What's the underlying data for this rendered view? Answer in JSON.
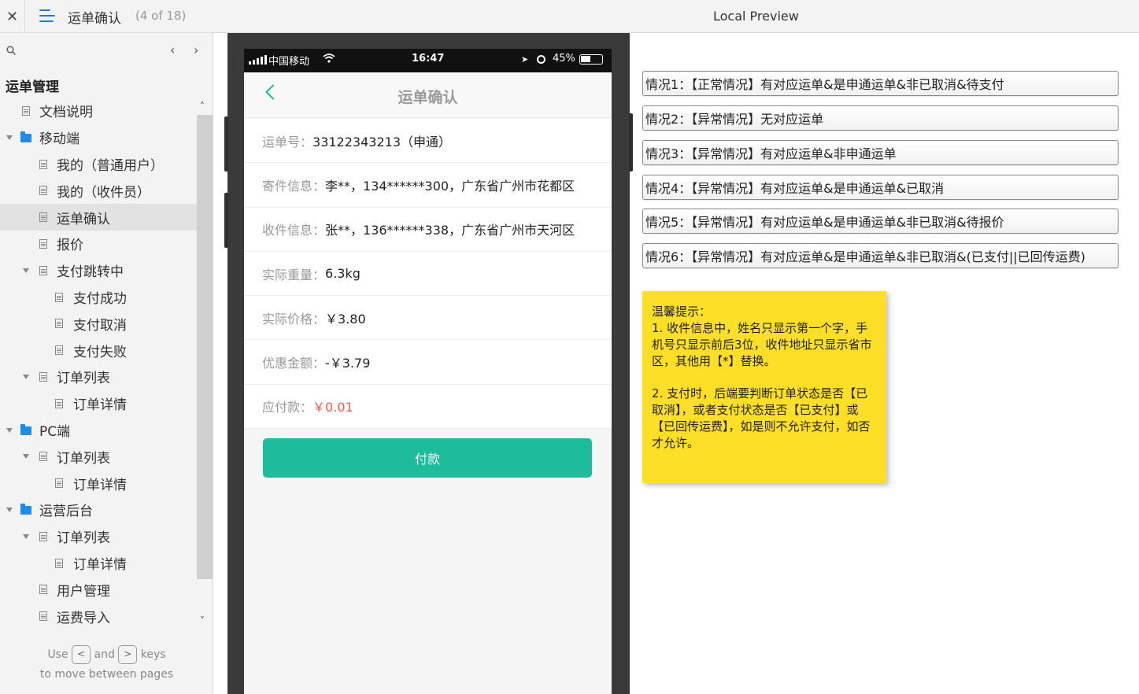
{
  "topbar": {
    "close_glyph": "✕",
    "page_title": "运单确认",
    "page_count": "(4 of 18)",
    "preview_title": "Local Preview"
  },
  "sidebar": {
    "tree_title": "运单管理",
    "items": [
      {
        "label": "文档说明",
        "type": "doc",
        "level": 1,
        "expanded": null,
        "selected": false
      },
      {
        "label": "移动端",
        "type": "folder",
        "level": 0,
        "expanded": true,
        "selected": false
      },
      {
        "label": "我的（普通用户）",
        "type": "doc",
        "level": 2,
        "expanded": null,
        "selected": false
      },
      {
        "label": "我的（收件员）",
        "type": "doc",
        "level": 2,
        "expanded": null,
        "selected": false
      },
      {
        "label": "运单确认",
        "type": "doc",
        "level": 2,
        "expanded": null,
        "selected": true
      },
      {
        "label": "报价",
        "type": "doc",
        "level": 2,
        "expanded": null,
        "selected": false
      },
      {
        "label": "支付跳转中",
        "type": "doc",
        "level": 1,
        "expanded": true,
        "selected": false
      },
      {
        "label": "支付成功",
        "type": "doc",
        "level": 3,
        "expanded": null,
        "selected": false
      },
      {
        "label": "支付取消",
        "type": "doc",
        "level": 3,
        "expanded": null,
        "selected": false
      },
      {
        "label": "支付失败",
        "type": "doc",
        "level": 3,
        "expanded": null,
        "selected": false
      },
      {
        "label": "订单列表",
        "type": "doc",
        "level": 1,
        "expanded": true,
        "selected": false
      },
      {
        "label": "订单详情",
        "type": "doc",
        "level": 3,
        "expanded": null,
        "selected": false
      },
      {
        "label": "PC端",
        "type": "folder",
        "level": 0,
        "expanded": true,
        "selected": false
      },
      {
        "label": "订单列表",
        "type": "doc",
        "level": 1,
        "expanded": true,
        "selected": false
      },
      {
        "label": "订单详情",
        "type": "doc",
        "level": 3,
        "expanded": null,
        "selected": false
      },
      {
        "label": "运营后台",
        "type": "folder",
        "level": 0,
        "expanded": true,
        "selected": false
      },
      {
        "label": "订单列表",
        "type": "doc",
        "level": 1,
        "expanded": true,
        "selected": false
      },
      {
        "label": "订单详情",
        "type": "doc",
        "level": 3,
        "expanded": null,
        "selected": false
      },
      {
        "label": "用户管理",
        "type": "doc",
        "level": 2,
        "expanded": null,
        "selected": false
      },
      {
        "label": "运费导入",
        "type": "doc",
        "level": 2,
        "expanded": null,
        "selected": false
      }
    ],
    "hint": {
      "use": "Use",
      "key_prev": "<",
      "and": "and",
      "key_next": ">",
      "keys": "keys",
      "line2": "to move between pages"
    }
  },
  "phone": {
    "carrier": "中国移动",
    "time": "16:47",
    "battery": "45%",
    "app_title": "运单确认",
    "rows": [
      {
        "key": "运单号：",
        "value": "33122343213（申通）",
        "red": false
      },
      {
        "key": "寄件信息：",
        "value": "李**，134******300，广东省广州市花都区",
        "red": false
      },
      {
        "key": "收件信息：",
        "value": "张**，136******338，广东省广州市天河区",
        "red": false
      },
      {
        "key": "实际重量：",
        "value": "6.3kg",
        "red": false
      },
      {
        "key": "实际价格：",
        "value": "￥3.80",
        "red": false
      },
      {
        "key": "优惠金额：",
        "value": "-￥3.79",
        "red": false
      },
      {
        "key": "应付款：",
        "value": "￥0.01",
        "red": true
      }
    ],
    "pay_label": "付款"
  },
  "cases": [
    "情况1：【正常情况】有对应运单&是申通运单&非已取消&待支付",
    "情况2：【异常情况】无对应运单",
    "情况3：【异常情况】有对应运单&非申通运单",
    "情况4：【异常情况】有对应运单&是申通运单&已取消",
    "情况5：【异常情况】有对应运单&是申通运单&非已取消&待报价",
    "情况6：【异常情况】有对应运单&是申通运单&非已取消&(已支付||已回传运费)"
  ],
  "sticky": {
    "title": "温馨提示：",
    "p1": "1. 收件信息中，姓名只显示第一个字，手机号只显示前后3位，收件地址只显示省市区，其他用【*】替换。",
    "p2": "2. 支付时，后端要判断订单状态是否【已取消】，或者支付状态是否【已支付】或【已回传运费】，如是则不允许支付，如否才允许。"
  },
  "colors": {
    "accent": "#1f8ce6",
    "pay_button": "#1dbd9b",
    "price_red": "#f25b4a",
    "sticky": "#fddf28"
  }
}
